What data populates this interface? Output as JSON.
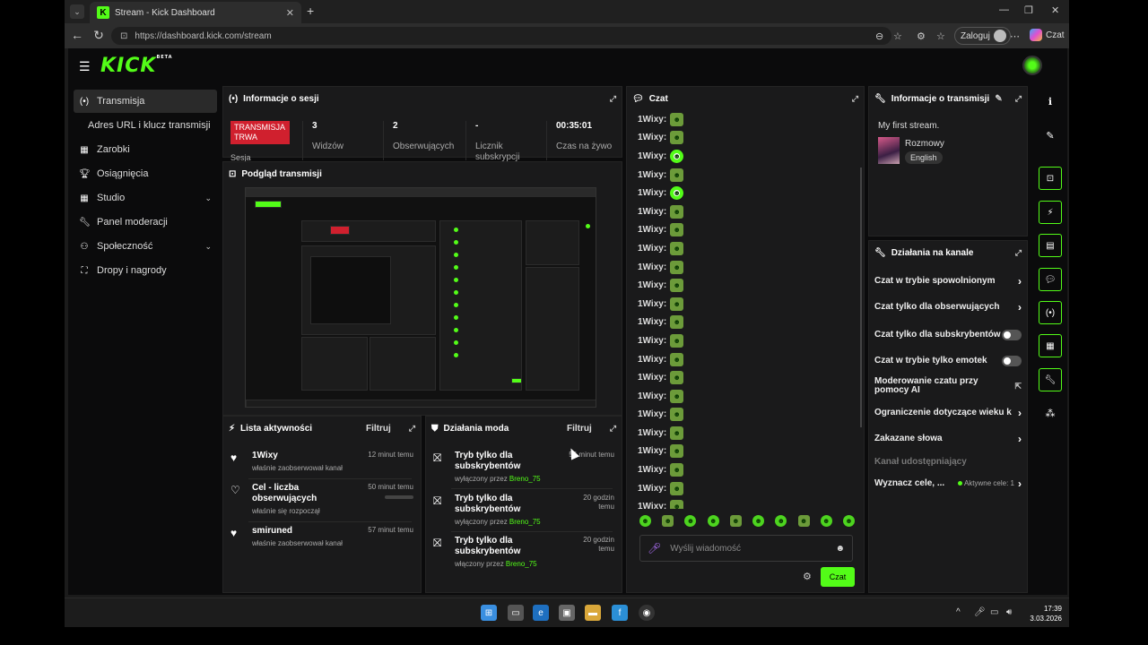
{
  "browser": {
    "tab_title": "Stream - Kick Dashboard",
    "url": "https://dashboard.kick.com/stream",
    "login_label": "Zaloguj",
    "copilot_label": "Czat"
  },
  "brand": {
    "logo": "KICK",
    "beta": "BETA",
    "accent": "#53fc18"
  },
  "sidebar": {
    "items": [
      {
        "label": "Transmisja",
        "icon": "broadcast-icon",
        "active": true
      },
      {
        "label": "Adres URL i klucz transmisji",
        "sub": true
      },
      {
        "label": "Zarobki",
        "icon": "grid-icon"
      },
      {
        "label": "Osiągnięcia",
        "icon": "trophy-icon"
      },
      {
        "label": "Studio",
        "icon": "grid-icon",
        "chevron": true
      },
      {
        "label": "Panel moderacji",
        "icon": "wrench-icon"
      },
      {
        "label": "Społeczność",
        "icon": "people-icon",
        "chevron": true
      },
      {
        "label": "Dropy i nagrody",
        "icon": "gift-icon"
      }
    ]
  },
  "session": {
    "title": "Informacje o sesji",
    "badge": "TRANSMISJA TRWA",
    "session_label": "Sesja",
    "stats": [
      {
        "value": "3",
        "label": "Widzów"
      },
      {
        "value": "2",
        "label": "Obserwujących"
      },
      {
        "value": "-",
        "label": "Licznik subskrypcji"
      },
      {
        "value": "00:35:01",
        "label": "Czas na żywo"
      }
    ]
  },
  "preview": {
    "title": "Podgląd transmisji"
  },
  "activity": {
    "title": "Lista aktywności",
    "filter": "Filtruj",
    "items": [
      {
        "title": "1Wixy",
        "sub": "właśnie zaobserwował kanał",
        "time": "12 minut temu"
      },
      {
        "title": "Cel - liczba obserwujących",
        "sub": "właśnie się rozpoczął",
        "time": "50 minut temu"
      },
      {
        "title": "smiruned",
        "sub": "właśnie zaobserwował kanał",
        "time": "57 minut temu"
      }
    ]
  },
  "modactions": {
    "title": "Działania moda",
    "filter": "Filtruj",
    "items": [
      {
        "title": "Tryb tylko dla subskrybentów",
        "sub": "wyłączony przez",
        "user": "Breno_75",
        "time": "56 minut temu"
      },
      {
        "title": "Tryb tylko dla subskrybentów",
        "sub": "wyłączony przez",
        "user": "Breno_75",
        "time": "20 godzin temu"
      },
      {
        "title": "Tryb tylko dla subskrybentów",
        "sub": "włączony przez",
        "user": "Breno_75",
        "time": "20 godzin temu"
      }
    ]
  },
  "chat": {
    "title": "Czat",
    "user": "1Wixy:",
    "messages": 22,
    "placeholder": "Wyślij wiadomość",
    "send": "Czat"
  },
  "streaminfo": {
    "title": "Informacje o transmisji",
    "stream_title": "My first stream.",
    "category": "Rozmowy",
    "language": "English"
  },
  "channel": {
    "title": "Działania na kanale",
    "items": [
      {
        "label": "Czat w trybie spowolnionym",
        "kind": "arrow"
      },
      {
        "label": "Czat tylko dla obserwujących",
        "kind": "arrow"
      },
      {
        "label": "Czat tylko dla subskrybentów",
        "kind": "toggle"
      },
      {
        "label": "Czat w trybie tylko emotek",
        "kind": "toggle"
      },
      {
        "label": "Moderowanie czatu przy pomocy AI",
        "kind": "external"
      },
      {
        "label": "Ograniczenie dotyczące wieku k",
        "kind": "arrow"
      },
      {
        "label": "Zakazane słowa",
        "kind": "arrow"
      },
      {
        "label": "Kanał udostępniający",
        "kind": "disabled"
      },
      {
        "label": "Wyznacz cele, ...",
        "kind": "goal",
        "extra": "Aktywne cele: 1"
      }
    ]
  },
  "taskbar": {
    "time": "17:39",
    "date": "3.03.2026"
  }
}
